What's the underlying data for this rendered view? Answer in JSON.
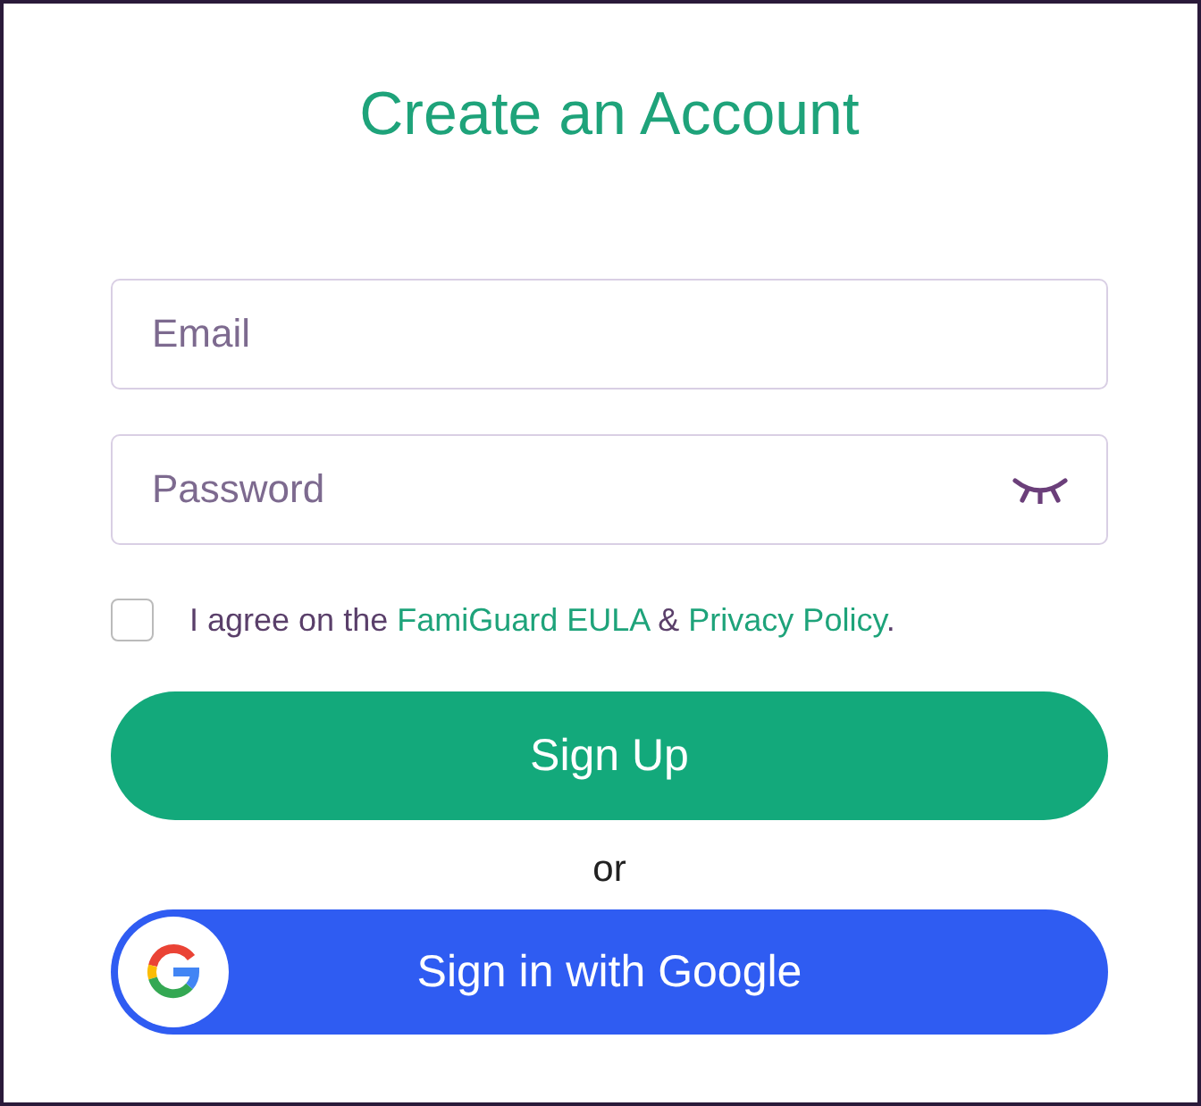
{
  "title": "Create an Account",
  "email": {
    "placeholder": "Email"
  },
  "password": {
    "placeholder": "Password"
  },
  "agreement": {
    "checked": false,
    "parts": [
      {
        "kind": "text",
        "text": "I agree on the "
      },
      {
        "kind": "link",
        "text": "FamiGuard EULA"
      },
      {
        "kind": "text",
        "text": " & "
      },
      {
        "kind": "link",
        "text": "Privacy Policy"
      },
      {
        "kind": "text",
        "text": "."
      }
    ]
  },
  "signup_button": "Sign Up",
  "separator": "or",
  "google_button": "Sign in with Google"
}
